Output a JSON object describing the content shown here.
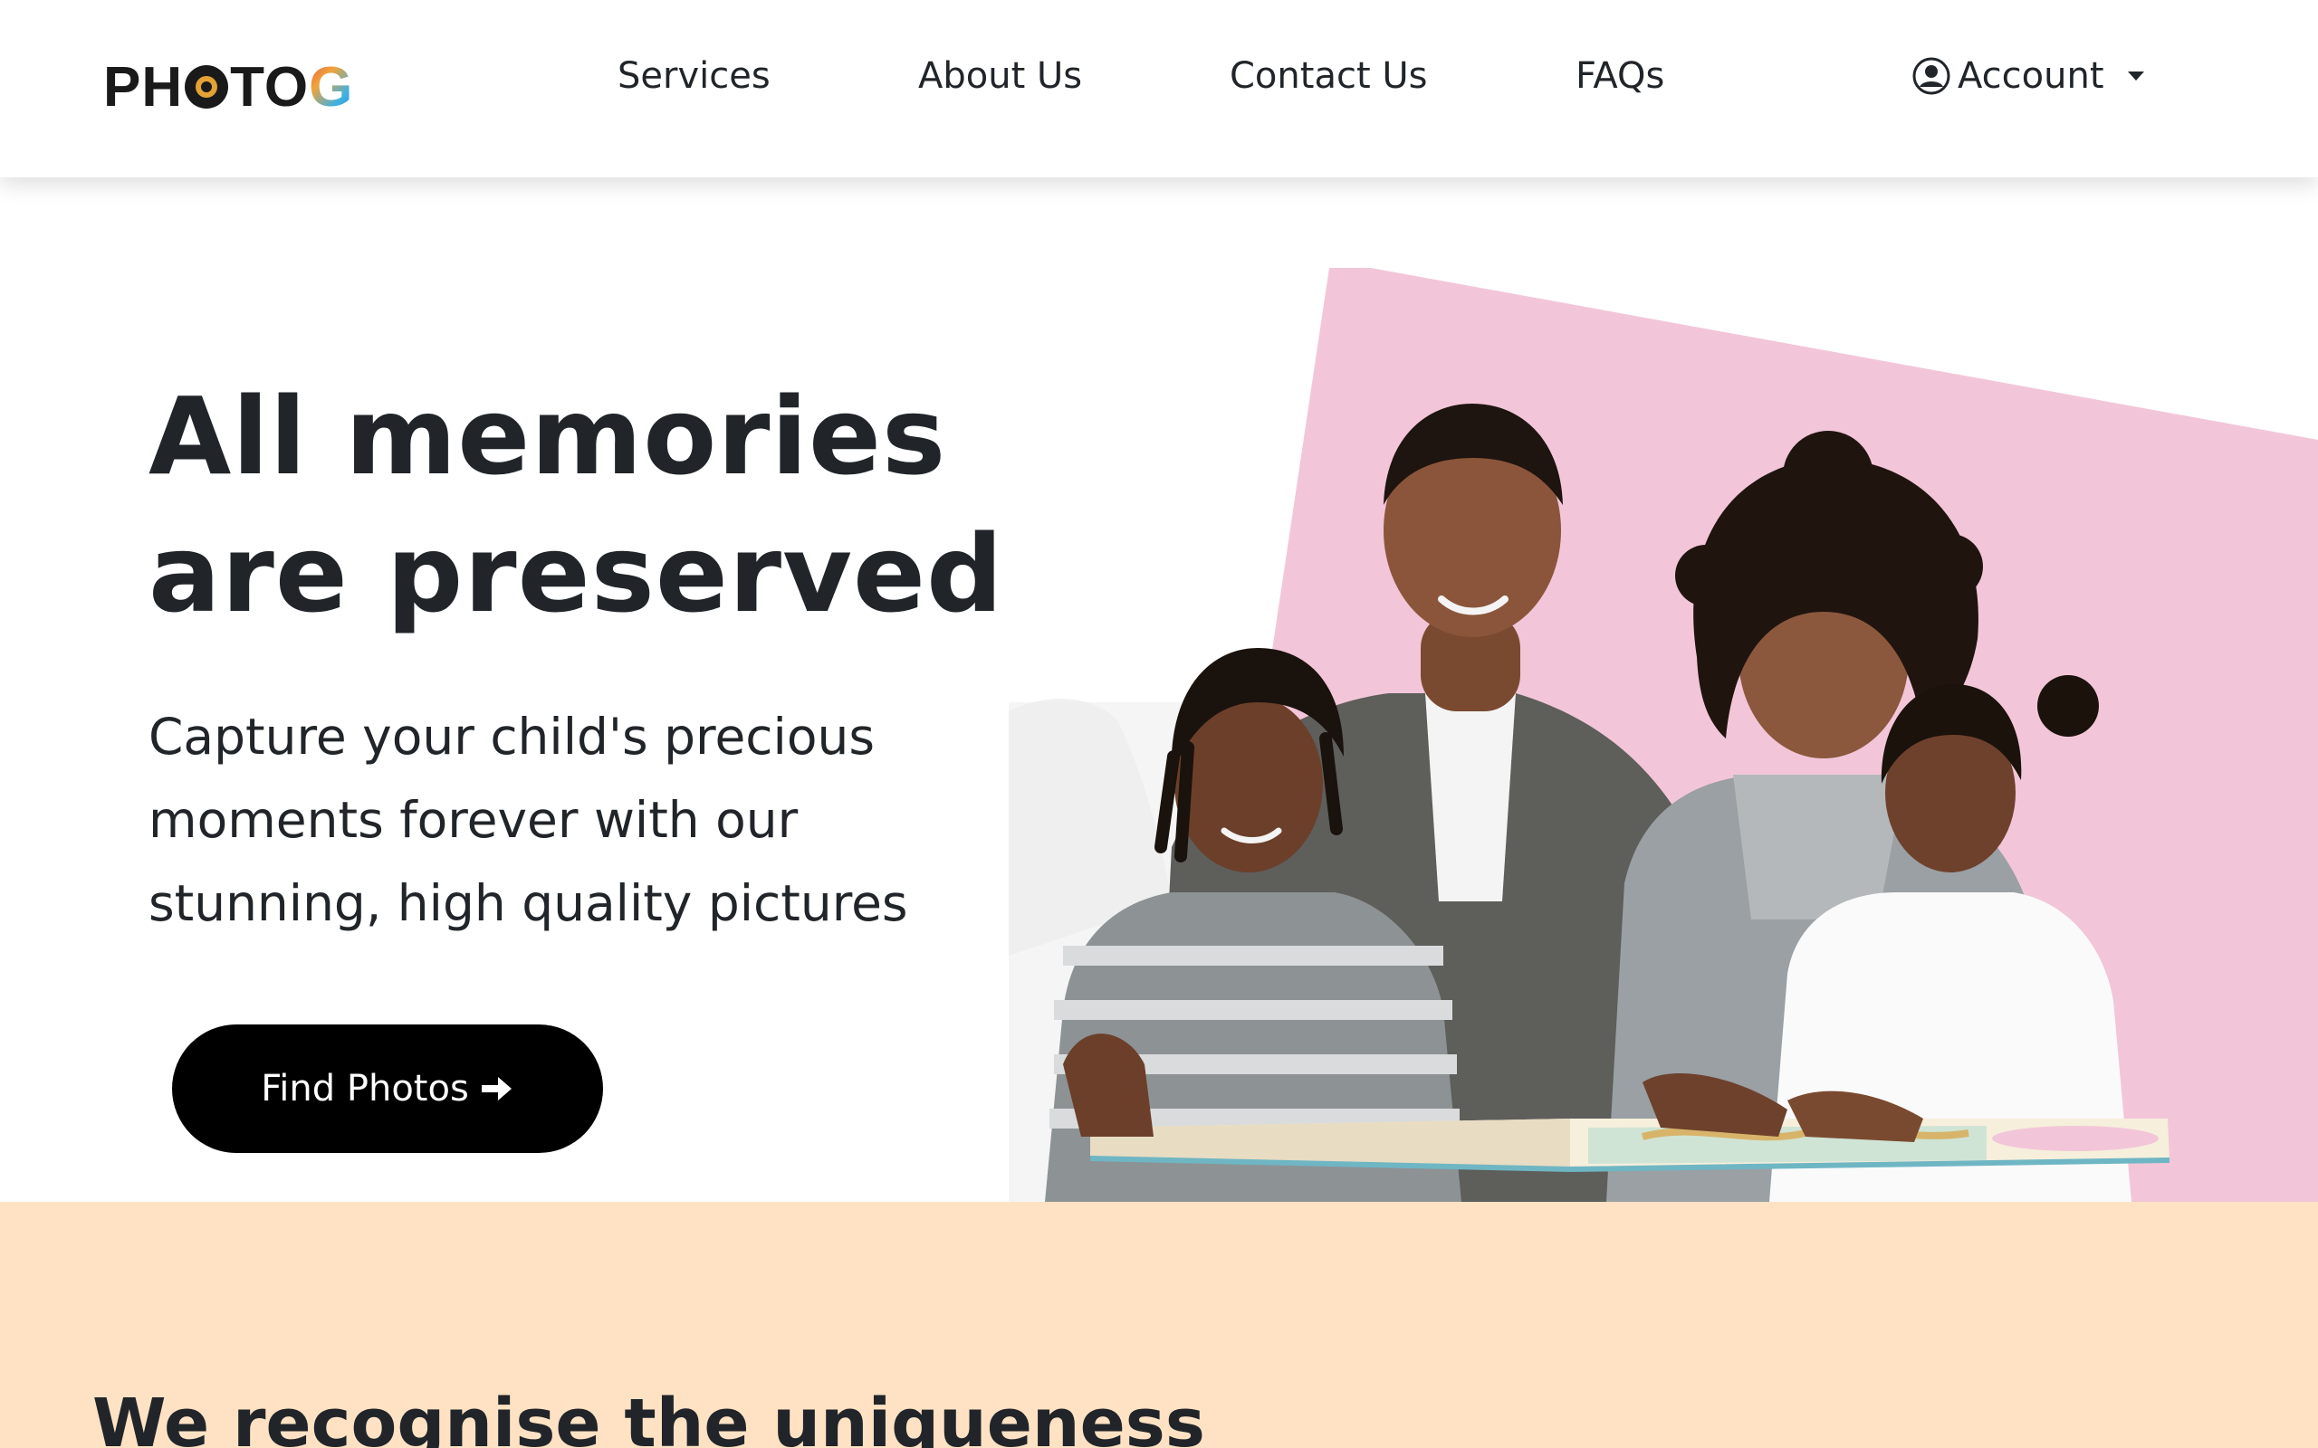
{
  "navbar": {
    "logo_text": "PHOTOG",
    "logo_colors": {
      "lens_ring": "#e3a235",
      "g_gradient": [
        "#e64a4a",
        "#f0a43a",
        "#3db1e3",
        "#3b7fd1"
      ]
    },
    "links": [
      "Services",
      "About Us",
      "Contact Us",
      "FAQs"
    ],
    "account_label": "Account",
    "account_icon": "user-circle-icon",
    "account_menu_icon": "caret-down-icon"
  },
  "hero": {
    "title_lines": [
      "All memories",
      "are preserved"
    ],
    "subtitle_lines": [
      "Capture your child's precious",
      "moments forever with our",
      "stunning, high quality pictures"
    ],
    "cta_label": "Find Photos",
    "cta_icon": "arrow-right-icon",
    "image_alt": "family-reading-book-photo",
    "accent_color": "#f2c6d8",
    "button_color": "#000000"
  },
  "uniqueness": {
    "title": "We recognise the uniqueness",
    "background_color": "#ffe2c4"
  }
}
